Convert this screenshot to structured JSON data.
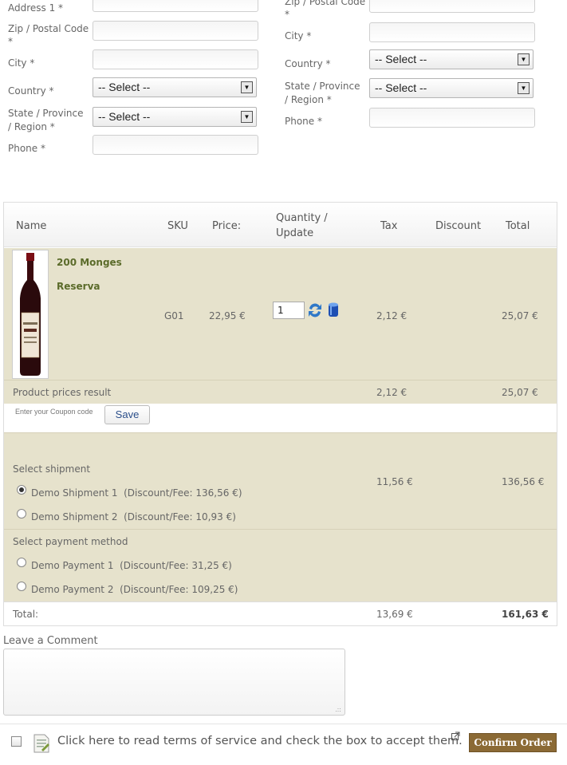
{
  "billing": {
    "address1_label": "Address 1 *",
    "zip_label": "Zip / Postal Code",
    "zip_star": "*",
    "city_label": "City *",
    "country_label": "Country *",
    "country_value": "-- Select --",
    "state_label_1": "State / Province",
    "state_label_2": "/ Region *",
    "state_value": "-- Select --",
    "phone_label": "Phone *"
  },
  "shipping": {
    "zip_label": "Zip / Postal Code",
    "zip_star": "*",
    "city_label": "City *",
    "country_label": "Country *",
    "country_value": "-- Select --",
    "state_label_1": "State / Province",
    "state_label_2": "/ Region *",
    "state_value": "-- Select --",
    "phone_label": "Phone *"
  },
  "cart": {
    "headers": {
      "name": "Name",
      "sku": "SKU",
      "price": "Price:",
      "qty_1": "Quantity /",
      "qty_2": "Update",
      "tax": "Tax",
      "discount": "Discount",
      "total": "Total"
    },
    "product": {
      "name_1": "200 Monges",
      "name_2": "Reserva",
      "sku": "G01",
      "price": "22,95 €",
      "quantity": "1",
      "tax": "2,12 €",
      "total": "25,07 €"
    },
    "prices_result": {
      "label": "Product prices result",
      "tax": "2,12 €",
      "total": "25,07 €"
    },
    "coupon": {
      "label": "Enter your Coupon code",
      "save": "Save"
    },
    "shipment": {
      "label": "Select shipment",
      "options": [
        {
          "name": "Demo Shipment 1",
          "fee": "(Discount/Fee: 136,56 €)",
          "selected": true
        },
        {
          "name": "Demo Shipment 2",
          "fee": "(Discount/Fee: 10,93 €)",
          "selected": false
        }
      ],
      "tax": "11,56 €",
      "total": "136,56 €"
    },
    "payment": {
      "label": "Select payment method",
      "options": [
        {
          "name": "Demo Payment 1",
          "fee": "(Discount/Fee: 31,25 €)",
          "selected": false
        },
        {
          "name": "Demo Payment 2",
          "fee": "(Discount/Fee: 109,25 €)",
          "selected": false
        }
      ]
    },
    "totals": {
      "label": "Total:",
      "tax": "13,69 €",
      "total": "161,63 €"
    }
  },
  "comment": {
    "label": "Leave a Comment"
  },
  "footer": {
    "tos_text": "Click here to read terms of service and check the box to accept them.",
    "confirm": "Confirm Order"
  },
  "colors": {
    "band": "#e6e2cc",
    "product_green": "#5b6b2a",
    "confirm_bg": "#8b6a35"
  }
}
